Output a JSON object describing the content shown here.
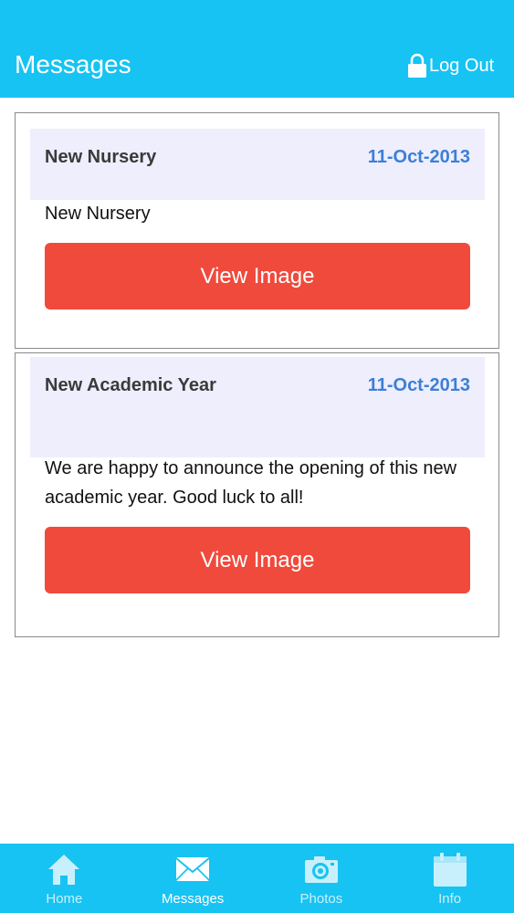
{
  "header": {
    "title": "Messages",
    "logout_label": "Log Out"
  },
  "messages": [
    {
      "title": "New Nursery",
      "date": "11-Oct-2013",
      "body": "New Nursery",
      "button_label": "View Image"
    },
    {
      "title": "New Academic Year",
      "date": "11-Oct-2013",
      "body": "We are happy to announce the opening of this new academic year. Good luck to all!",
      "button_label": "View Image"
    }
  ],
  "tabs": [
    {
      "label": "Home",
      "icon": "home-icon",
      "active": false
    },
    {
      "label": "Messages",
      "icon": "envelope-icon",
      "active": true
    },
    {
      "label": "Photos",
      "icon": "camera-icon",
      "active": false
    },
    {
      "label": "Info",
      "icon": "calendar-icon",
      "active": false
    }
  ],
  "colors": {
    "header_bg": "#17c3f2",
    "button_bg": "#ef4a3c",
    "date_text": "#3d7fd6",
    "card_head_bg": "#eeeefd"
  }
}
